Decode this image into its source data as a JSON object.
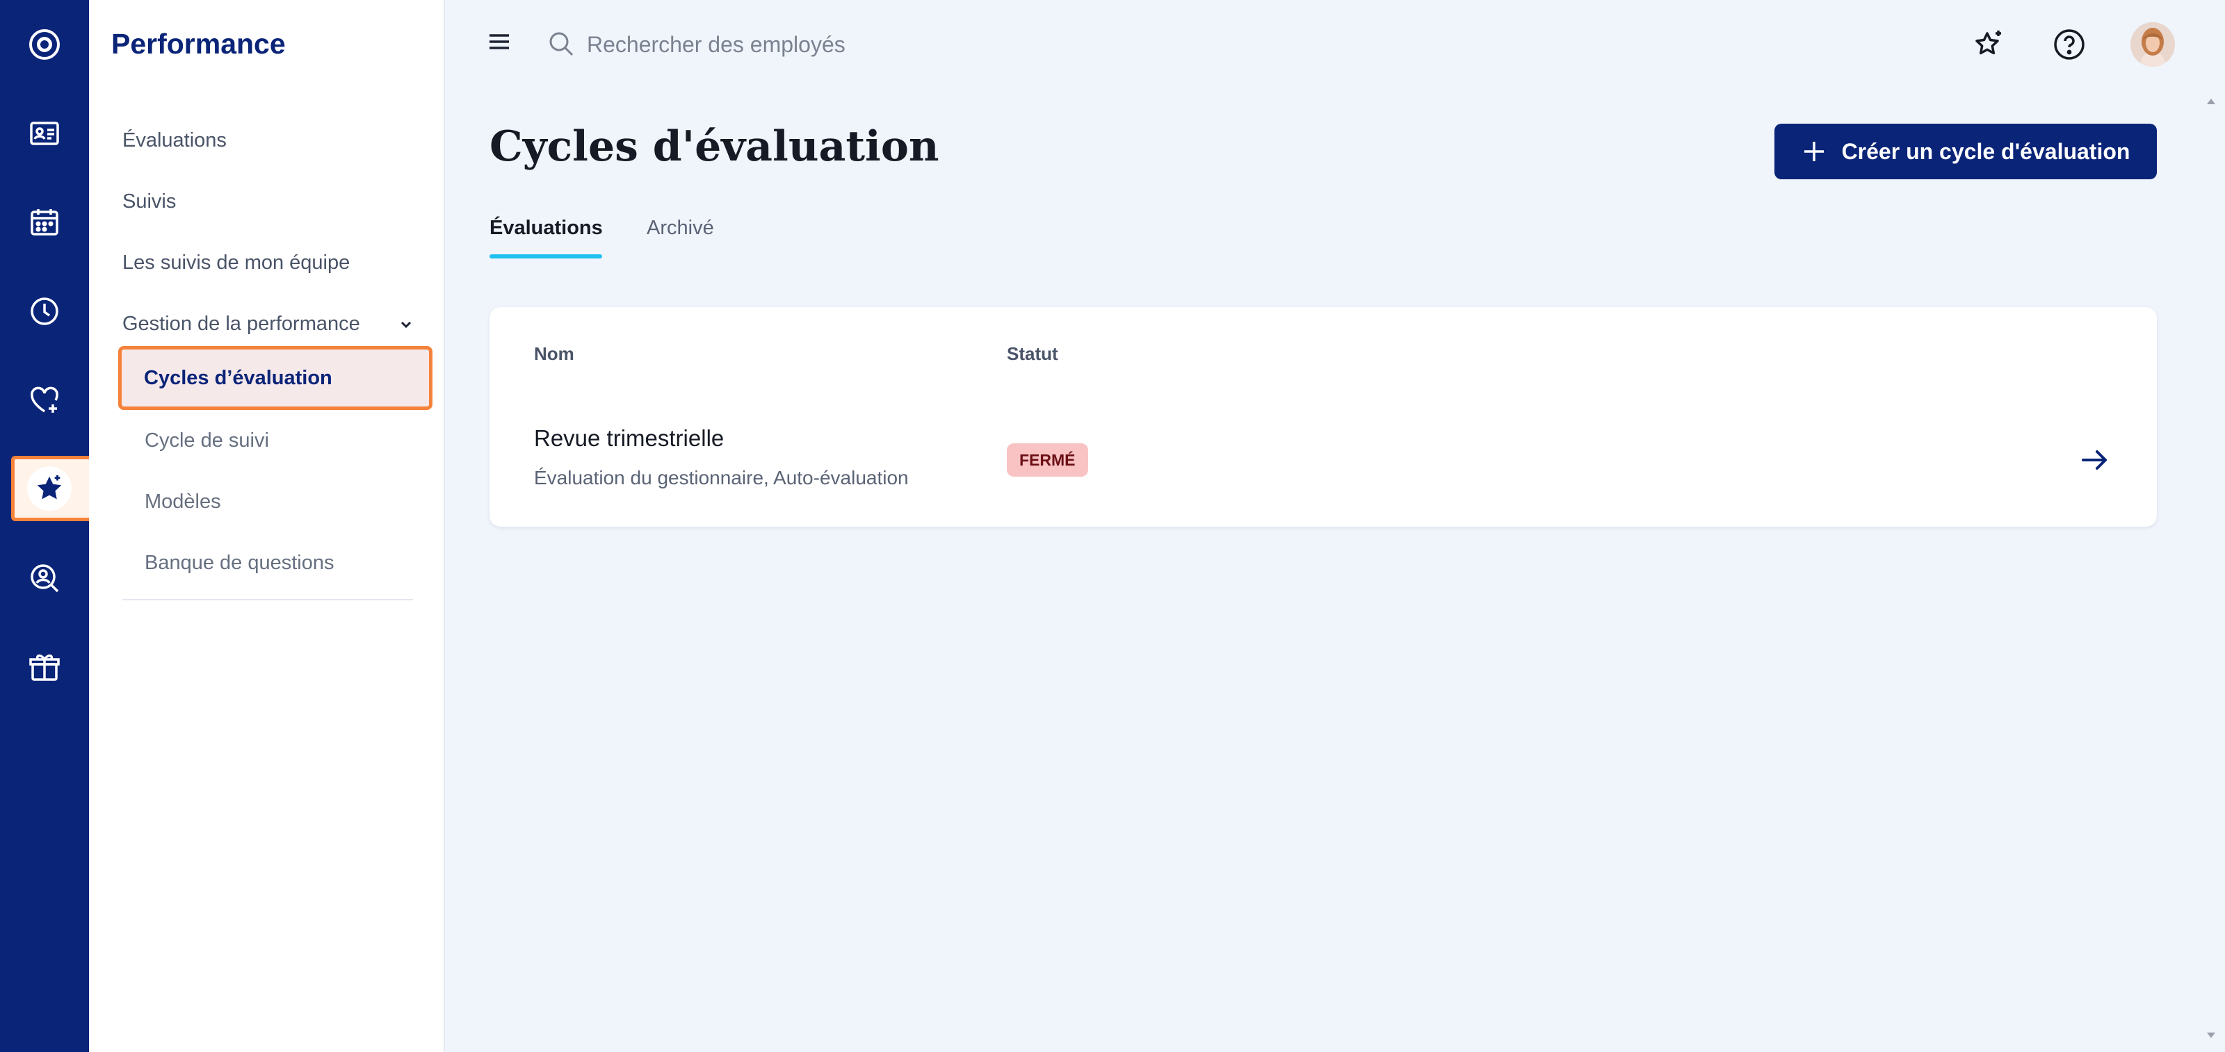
{
  "subnav": {
    "title": "Performance",
    "items": [
      {
        "label": "Évaluations"
      },
      {
        "label": "Suivis"
      },
      {
        "label": "Les suivis de mon équipe"
      }
    ],
    "group_label": "Gestion de la performance",
    "children": [
      {
        "label": "Cycles d’évaluation"
      },
      {
        "label": "Cycle de suivi"
      },
      {
        "label": "Modèles"
      },
      {
        "label": "Banque de questions"
      }
    ]
  },
  "search": {
    "placeholder": "Rechercher des employés"
  },
  "main": {
    "title": "Cycles d'évaluation",
    "create_button": "Créer un cycle d'évaluation",
    "tabs": [
      {
        "label": "Évaluations"
      },
      {
        "label": "Archivé"
      }
    ],
    "table": {
      "columns": [
        "Nom",
        "Statut"
      ],
      "rows": [
        {
          "name": "Revue trimestrielle",
          "description": "Évaluation du gestionnaire, Auto-évaluation",
          "status": "FERMÉ"
        }
      ]
    }
  },
  "colors": {
    "brand": "#0a2478",
    "highlight": "#f5823a",
    "tab_accent": "#1fc0f0",
    "closed_badge": "#f9c3c4"
  }
}
